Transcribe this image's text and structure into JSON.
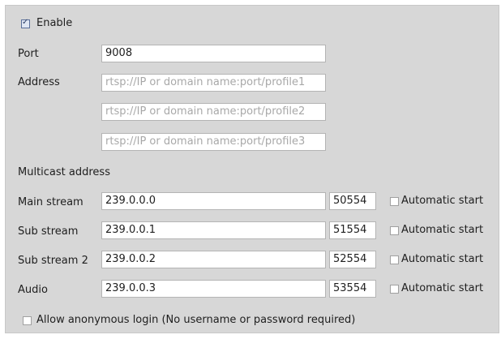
{
  "enable": {
    "label": "Enable",
    "checked": true
  },
  "port": {
    "label": "Port",
    "value": "9008"
  },
  "address": {
    "label": "Address",
    "fields": [
      {
        "value": "",
        "placeholder": "rtsp://IP or domain name:port/profile1"
      },
      {
        "value": "",
        "placeholder": "rtsp://IP or domain name:port/profile2"
      },
      {
        "value": "",
        "placeholder": "rtsp://IP or domain name:port/profile3"
      }
    ]
  },
  "multicast": {
    "heading": "Multicast address",
    "auto_label": "Automatic start",
    "rows": [
      {
        "label": "Main stream",
        "ip": "239.0.0.0",
        "port": "50554",
        "auto": false
      },
      {
        "label": "Sub stream",
        "ip": "239.0.0.1",
        "port": "51554",
        "auto": false
      },
      {
        "label": "Sub stream 2",
        "ip": "239.0.0.2",
        "port": "52554",
        "auto": false
      },
      {
        "label": "Audio",
        "ip": "239.0.0.3",
        "port": "53554",
        "auto": false
      }
    ]
  },
  "anonymous": {
    "label": "Allow anonymous login (No username or password required)",
    "checked": false
  }
}
